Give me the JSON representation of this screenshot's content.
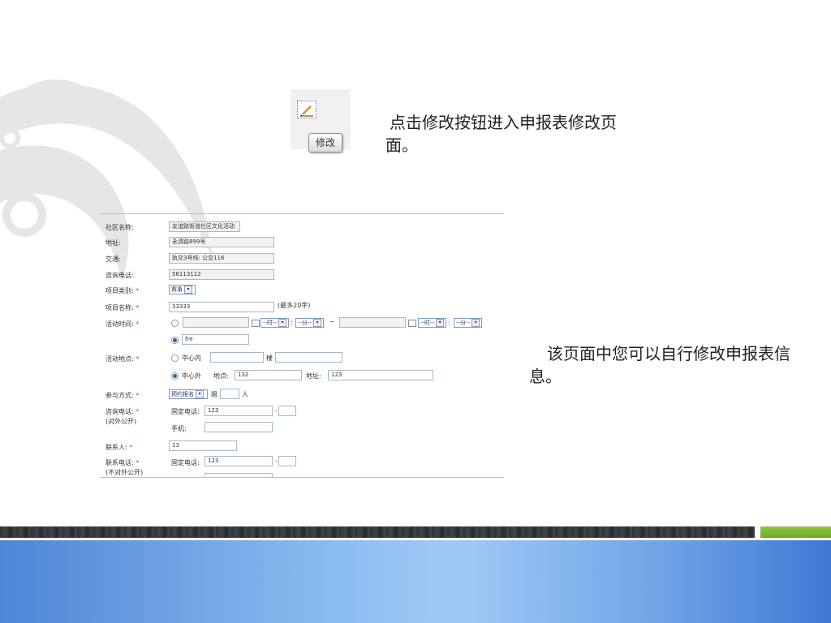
{
  "edit_button_label": "修改",
  "caption_top": "点击修改按钮进入申报表修改页面。",
  "caption_right": "该页面中您可以自行修改申报表信息。",
  "form": {
    "community_name_label": "社区名称:",
    "community_name_value": "友谊路街道社区文化活动",
    "address_label": "地址:",
    "address_value": "永清路899号",
    "traffic_label": "交通:",
    "traffic_value": "轨交3号线: 公交116",
    "consult_phone_label": "咨询电话:",
    "consult_phone_value": "56113112",
    "category_label": "项目类别:",
    "category_value": "赛事",
    "project_name_label": "项目名称:",
    "project_name_value": "33333",
    "project_name_hint": "(最多20字)",
    "time_label": "活动时间:",
    "hour_select": "--时--",
    "minute_select": "--分--",
    "time_sep_colon": ":",
    "time_range_sep": "~",
    "time_custom_value": "fre",
    "location_label": "活动地点:",
    "center_inside": "中心内",
    "building_label": "楼",
    "center_outside": "中心外",
    "place_label": "地点:",
    "place_value": "132",
    "addr_label": "地址:",
    "addr_value": "123",
    "participation_label": "参与方式:",
    "participation_value": "预约报名",
    "limit_label": "限",
    "person_unit": "人",
    "consult_phone2_label": "咨询电话:",
    "public_note": "(对外公开)",
    "fixed_phone_label": "固定电话:",
    "fixed_phone_value": "123",
    "dash": "-",
    "mobile_label": "手机:",
    "contact_label": "联系人:",
    "contact_value": "13",
    "contact_phone_label": "联系电话:",
    "private_note": "(不对外公开)",
    "fixed_phone2_value": "123",
    "required_mark": "*"
  }
}
